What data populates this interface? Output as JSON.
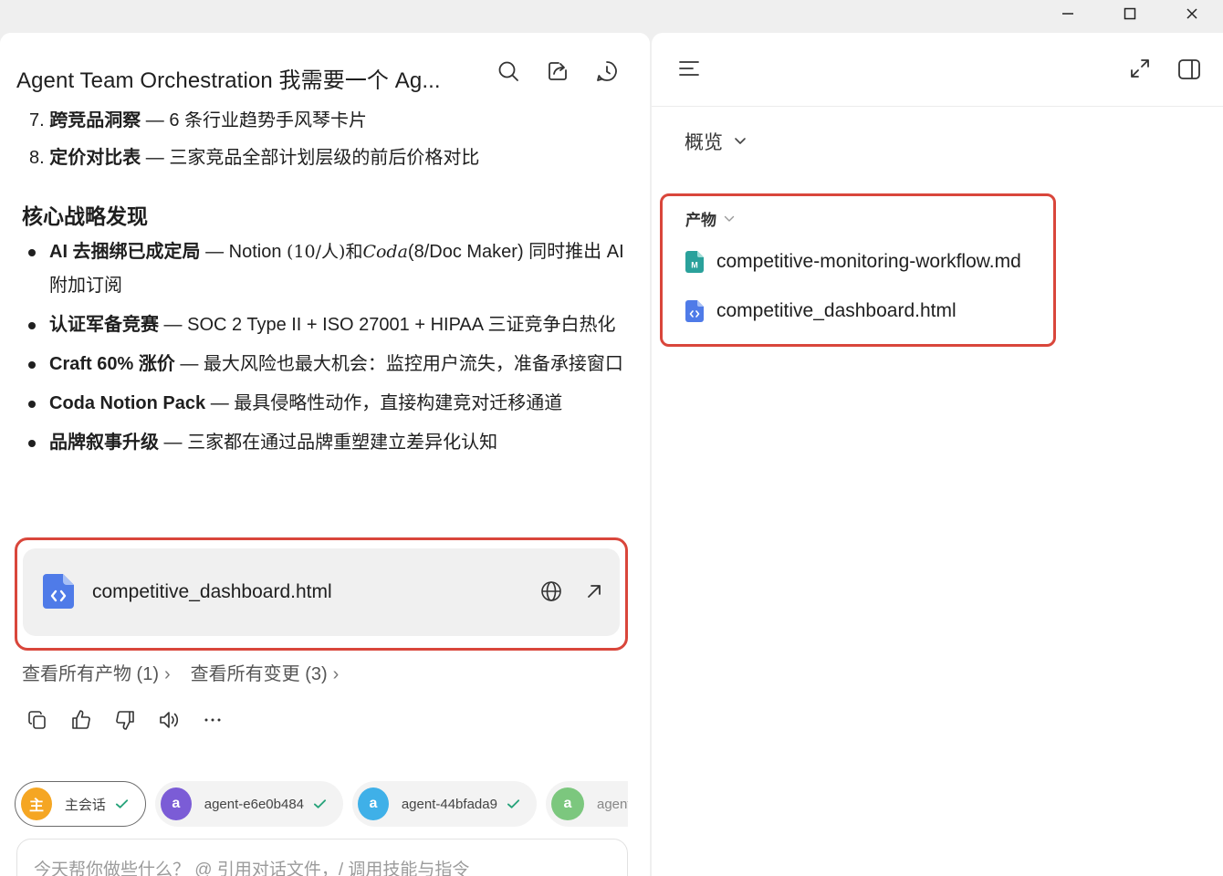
{
  "window": {
    "controls": [
      "minimize-icon",
      "maximize-icon",
      "close-icon"
    ]
  },
  "left": {
    "title": "Agent Team Orchestration 我需要一个 Ag...",
    "clipped_line_prefix": "7. ",
    "clipped_line_bold": "跨竞品洞察",
    "clipped_line_rest": " — 6 条行业趋势手风琴卡片",
    "list_item_8": {
      "number": "8. ",
      "bold": "定价对比表",
      "rest": " — 三家竞品全部计划层级的前后价格对比"
    },
    "section_title": "核心战略发现",
    "bullets": [
      {
        "bold": "AI 去捆绑已成定局",
        "pre": " — Notion ",
        "math1": "(10/人)和",
        "math_italic": "Coda",
        "post": "(8/Doc Maker) 同时推出 AI 附加订阅"
      },
      {
        "bold": "认证军备竞赛",
        "rest": " — SOC 2 Type II + ISO 27001 + HIPAA 三证竞争白热化"
      },
      {
        "bold": "Craft 60% 涨价",
        "rest": " — 最大风险也最大机会：监控用户流失，准备承接窗口"
      },
      {
        "bold": "Coda Notion Pack",
        "rest": " — 最具侵略性动作，直接构建竞对迁移通道"
      },
      {
        "bold": "品牌叙事升级",
        "rest": " — 三家都在通过品牌重塑建立差异化认知"
      }
    ],
    "file_card": {
      "name": "competitive_dashboard.html"
    },
    "links": {
      "artifacts": "查看所有产物 (1)",
      "changes": "查看所有变更 (3)"
    },
    "agents": [
      {
        "avatar": "主",
        "label": "主会话",
        "color": "#f5a623"
      },
      {
        "avatar": "a",
        "label": "agent-e6e0b484",
        "color": "#7b5cd6"
      },
      {
        "avatar": "a",
        "label": "agent-44bfada9",
        "color": "#3fb0e8"
      },
      {
        "avatar": "a",
        "label": "agent",
        "color": "#7cc77e"
      }
    ],
    "input_placeholder": "今天帮你做些什么？ @ 引用对话文件，/ 调用技能与指令"
  },
  "right": {
    "overview_label": "概览",
    "artifacts_title": "产物",
    "files": [
      {
        "name": "competitive-monitoring-workflow.md",
        "icon": "markdown-file-icon",
        "badge": "M"
      },
      {
        "name": "competitive_dashboard.html",
        "icon": "html-file-icon",
        "badge": "<>"
      }
    ]
  }
}
